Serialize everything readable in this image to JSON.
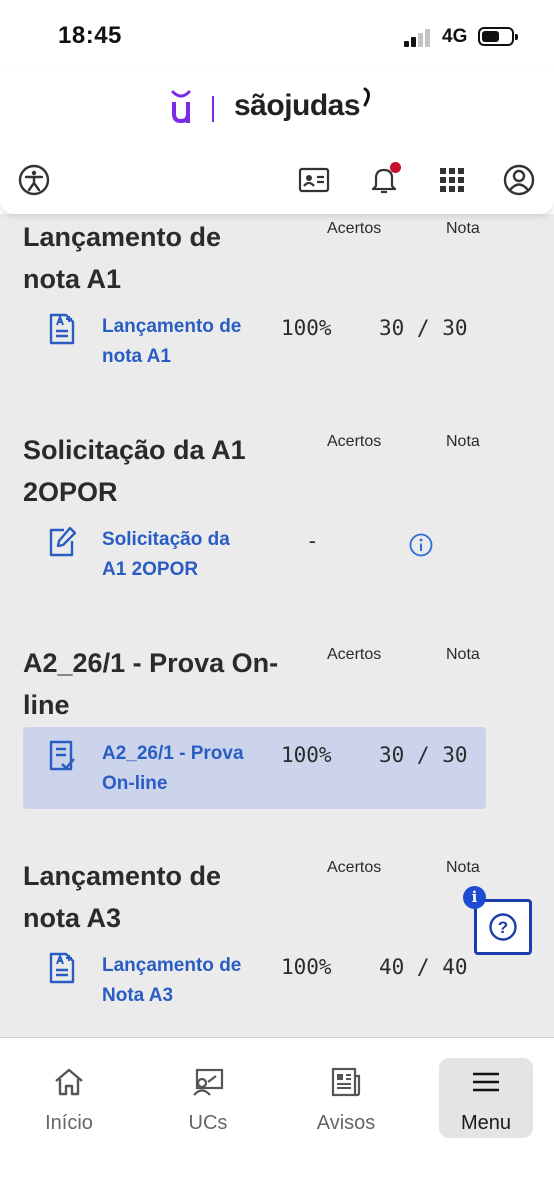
{
  "status_bar": {
    "time": "18:45",
    "network": "4G"
  },
  "header": {
    "brand_text": "sãojudas",
    "icons": [
      "accessibility-icon",
      "id-card-icon",
      "bell-icon",
      "apps-grid-icon",
      "user-icon"
    ]
  },
  "columns": {
    "hits": "Acertos",
    "grade": "Nota"
  },
  "sections": [
    {
      "title": "Lançamento de nota A1",
      "item_label": "Lançamento de nota A1",
      "percent": "100%",
      "grade": "30 / 30",
      "icon": "grade-entry-icon",
      "highlighted": false
    },
    {
      "title": "Solicitação da A1 2OPOR",
      "item_label": "Solicitação da A1 2OPOR",
      "percent": "-",
      "grade": "",
      "icon": "edit-icon",
      "highlighted": false
    },
    {
      "title": "A2_26/1 - Prova On-line",
      "item_label": "A2_26/1 - Prova On-line",
      "percent": "100%",
      "grade": "30 / 30",
      "icon": "checklist-icon",
      "highlighted": true
    },
    {
      "title": "Lançamento de nota A3",
      "item_label": "Lançamento de Nota A3",
      "percent": "100%",
      "grade": "40 / 40",
      "icon": "grade-entry-icon",
      "highlighted": false
    }
  ],
  "help": {
    "badge": "i",
    "symbol": "?"
  },
  "bottom_nav": [
    {
      "label": "Início",
      "icon": "home-icon"
    },
    {
      "label": "UCs",
      "icon": "classroom-icon"
    },
    {
      "label": "Avisos",
      "icon": "news-icon"
    },
    {
      "label": "Menu",
      "icon": "menu-icon",
      "active": true
    }
  ],
  "colors": {
    "brand": "#7d2ae8",
    "link": "#2a5dc4",
    "highlight_row": "#ccd4ec",
    "notification": "#c8102e",
    "help": "#1c3caa"
  }
}
